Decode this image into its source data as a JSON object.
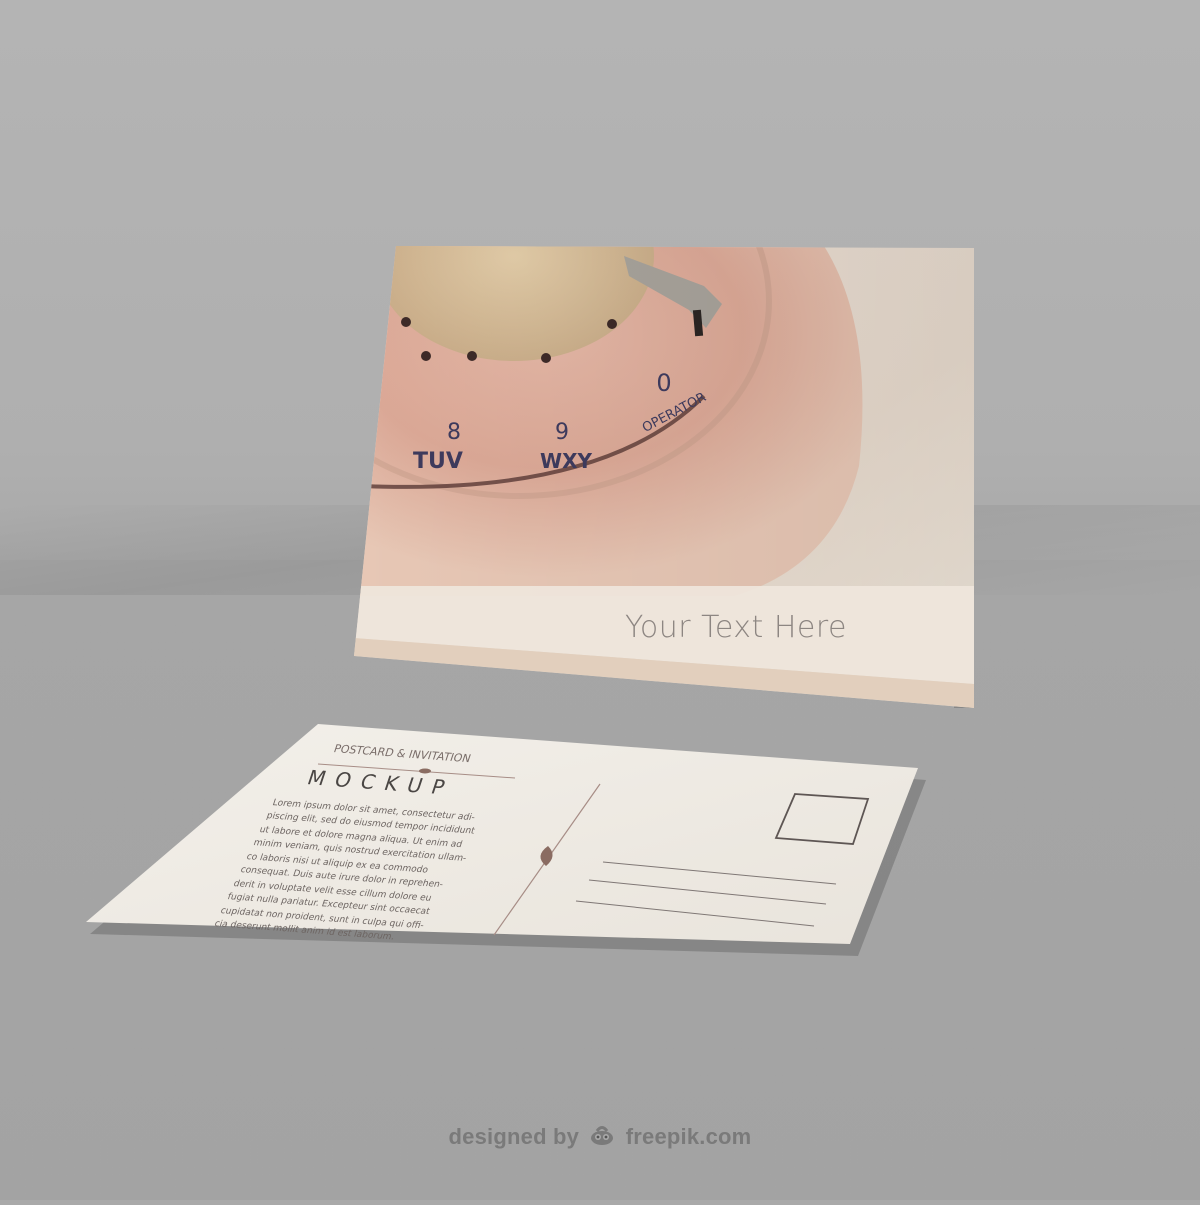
{
  "front_card": {
    "caption": "Your Text Here",
    "dial_letters": [
      "TUV",
      "WXY"
    ],
    "dial_numbers": [
      "8",
      "9",
      "0"
    ],
    "dial_operator": "OPERATOR"
  },
  "back_card": {
    "header_top": "POSTCARD & INVITATION",
    "header_main": "MOCKUP",
    "body_text": [
      "Lorem ipsum dolor sit amet, consectetur adi-",
      "piscing elit, sed do eiusmod tempor incididunt",
      "ut labore et dolore magna aliqua. Ut enim ad",
      "minim veniam, quis nostrud exercitation ullam-",
      "co laboris nisi ut aliquip ex ea commodo",
      "consequat. Duis aute irure dolor in reprehen-",
      "derit in voluptate velit esse cillum dolore eu",
      "fugiat nulla pariatur. Excepteur sint occaecat",
      "cupidatat non proident, sunt in culpa qui offi-",
      "cia deserunt mollit anim id est laborum."
    ]
  },
  "credit": {
    "prefix": "designed by",
    "brand": "freepik.com"
  },
  "colors": {
    "background": "#aaaaaa",
    "card_paper": "#efebe4",
    "phone_pink": "#d9a796",
    "accent_brown": "#8a6c62",
    "credit_gray": "#7a7a7a"
  }
}
